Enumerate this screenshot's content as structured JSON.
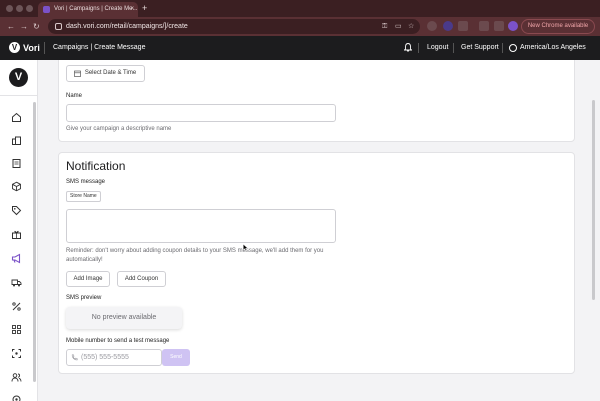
{
  "browser": {
    "tab_title": "Vori | Campaigns | Create Me...",
    "tab_close": "×",
    "new_tab": "+",
    "url": "dash.vori.com/retail/campaigns/]/create",
    "new_chrome": "New Chrome available"
  },
  "header": {
    "brand": "Vori",
    "title": "Campaigns | Create Message",
    "logout": "Logout",
    "support": "Get Support",
    "timezone": "America/Los Angeles"
  },
  "schedule": {
    "date_button": "Select Date & Time",
    "name_label": "Name",
    "name_hint": "Give your campaign a descriptive name"
  },
  "notification": {
    "heading": "Notification",
    "sms_label": "SMS message",
    "store_chip": "Store Name",
    "reminder": "Reminder: don't worry about adding coupon details to your SMS message, we'll add them for you automatically!",
    "add_image": "Add Image",
    "add_coupon": "Add Coupon",
    "preview_label": "SMS preview",
    "no_preview": "No preview available",
    "mobile_label": "Mobile number to send a test message",
    "phone_placeholder": "(555) 555-5555",
    "send": "Send"
  },
  "colors": {
    "accent": "#7b52c8",
    "send_disabled": "#cfc3f3",
    "app_header": "#1c1c1e",
    "browser": "#5a3034"
  }
}
